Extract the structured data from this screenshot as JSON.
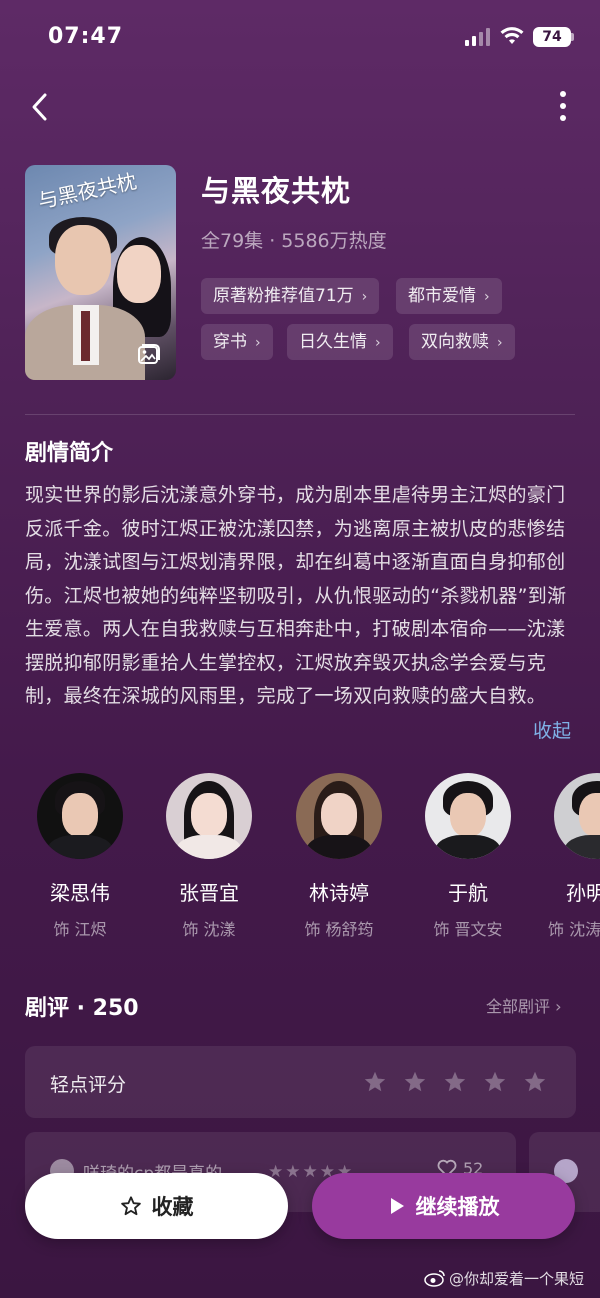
{
  "status_bar": {
    "time": "07:47",
    "battery": "74"
  },
  "show": {
    "title": "与黑夜共枕",
    "meta": "全79集 · 5586万热度",
    "poster_title": "与黑夜共枕",
    "tags": [
      "原著粉推荐值71万",
      "都市爱情",
      "穿书",
      "日久生情",
      "双向救赎"
    ],
    "tag_chevron": "›"
  },
  "synopsis": {
    "heading": "剧情简介",
    "text": "现实世界的影后沈漾意外穿书，成为剧本里虐待男主江烬的豪门反派千金。彼时江烬正被沈漾囚禁，为逃离原主被扒皮的悲惨结局，沈漾试图与江烬划清界限，却在纠葛中逐渐直面自身抑郁创伤。江烬也被她的纯粹坚韧吸引，从仇恨驱动的“杀戮机器”到渐生爱意。两人在自我救赎与互相奔赴中，打破剧本宿命——沈漾摆脱抑郁阴影重拾人生掌控权，江烬放弃毁灭执念学会爱与克制，最终在深城的风雨里，完成了一场双向救赎的盛大自救。",
    "collapse": "收起"
  },
  "cast": [
    {
      "name": "梁思伟",
      "role": "饰 江烬"
    },
    {
      "name": "张晋宜",
      "role": "饰 沈漾"
    },
    {
      "name": "林诗婷",
      "role": "饰 杨舒筠"
    },
    {
      "name": "于航",
      "role": "饰 晋文安"
    },
    {
      "name": "孙明",
      "role": "饰 沈涛"
    }
  ],
  "reviews": {
    "heading": "剧评 · 250",
    "all_link": "全部剧评 ›",
    "rating_label": "轻点评分",
    "first_review_text": "咩琦的cp都是真的",
    "first_review_stars": "★★★★★",
    "first_review_likes": "52"
  },
  "actions": {
    "favorite": "收藏",
    "play": "继续播放"
  },
  "watermark": "@你却爱着一个果短",
  "colors": {
    "background": "#4f2257",
    "accent": "#983a9e",
    "link": "#7fb1e6"
  },
  "icons": [
    "back-arrow-icon",
    "more-vertical-icon",
    "gallery-icon",
    "star-icon",
    "heart-icon",
    "play-icon",
    "weibo-icon"
  ]
}
